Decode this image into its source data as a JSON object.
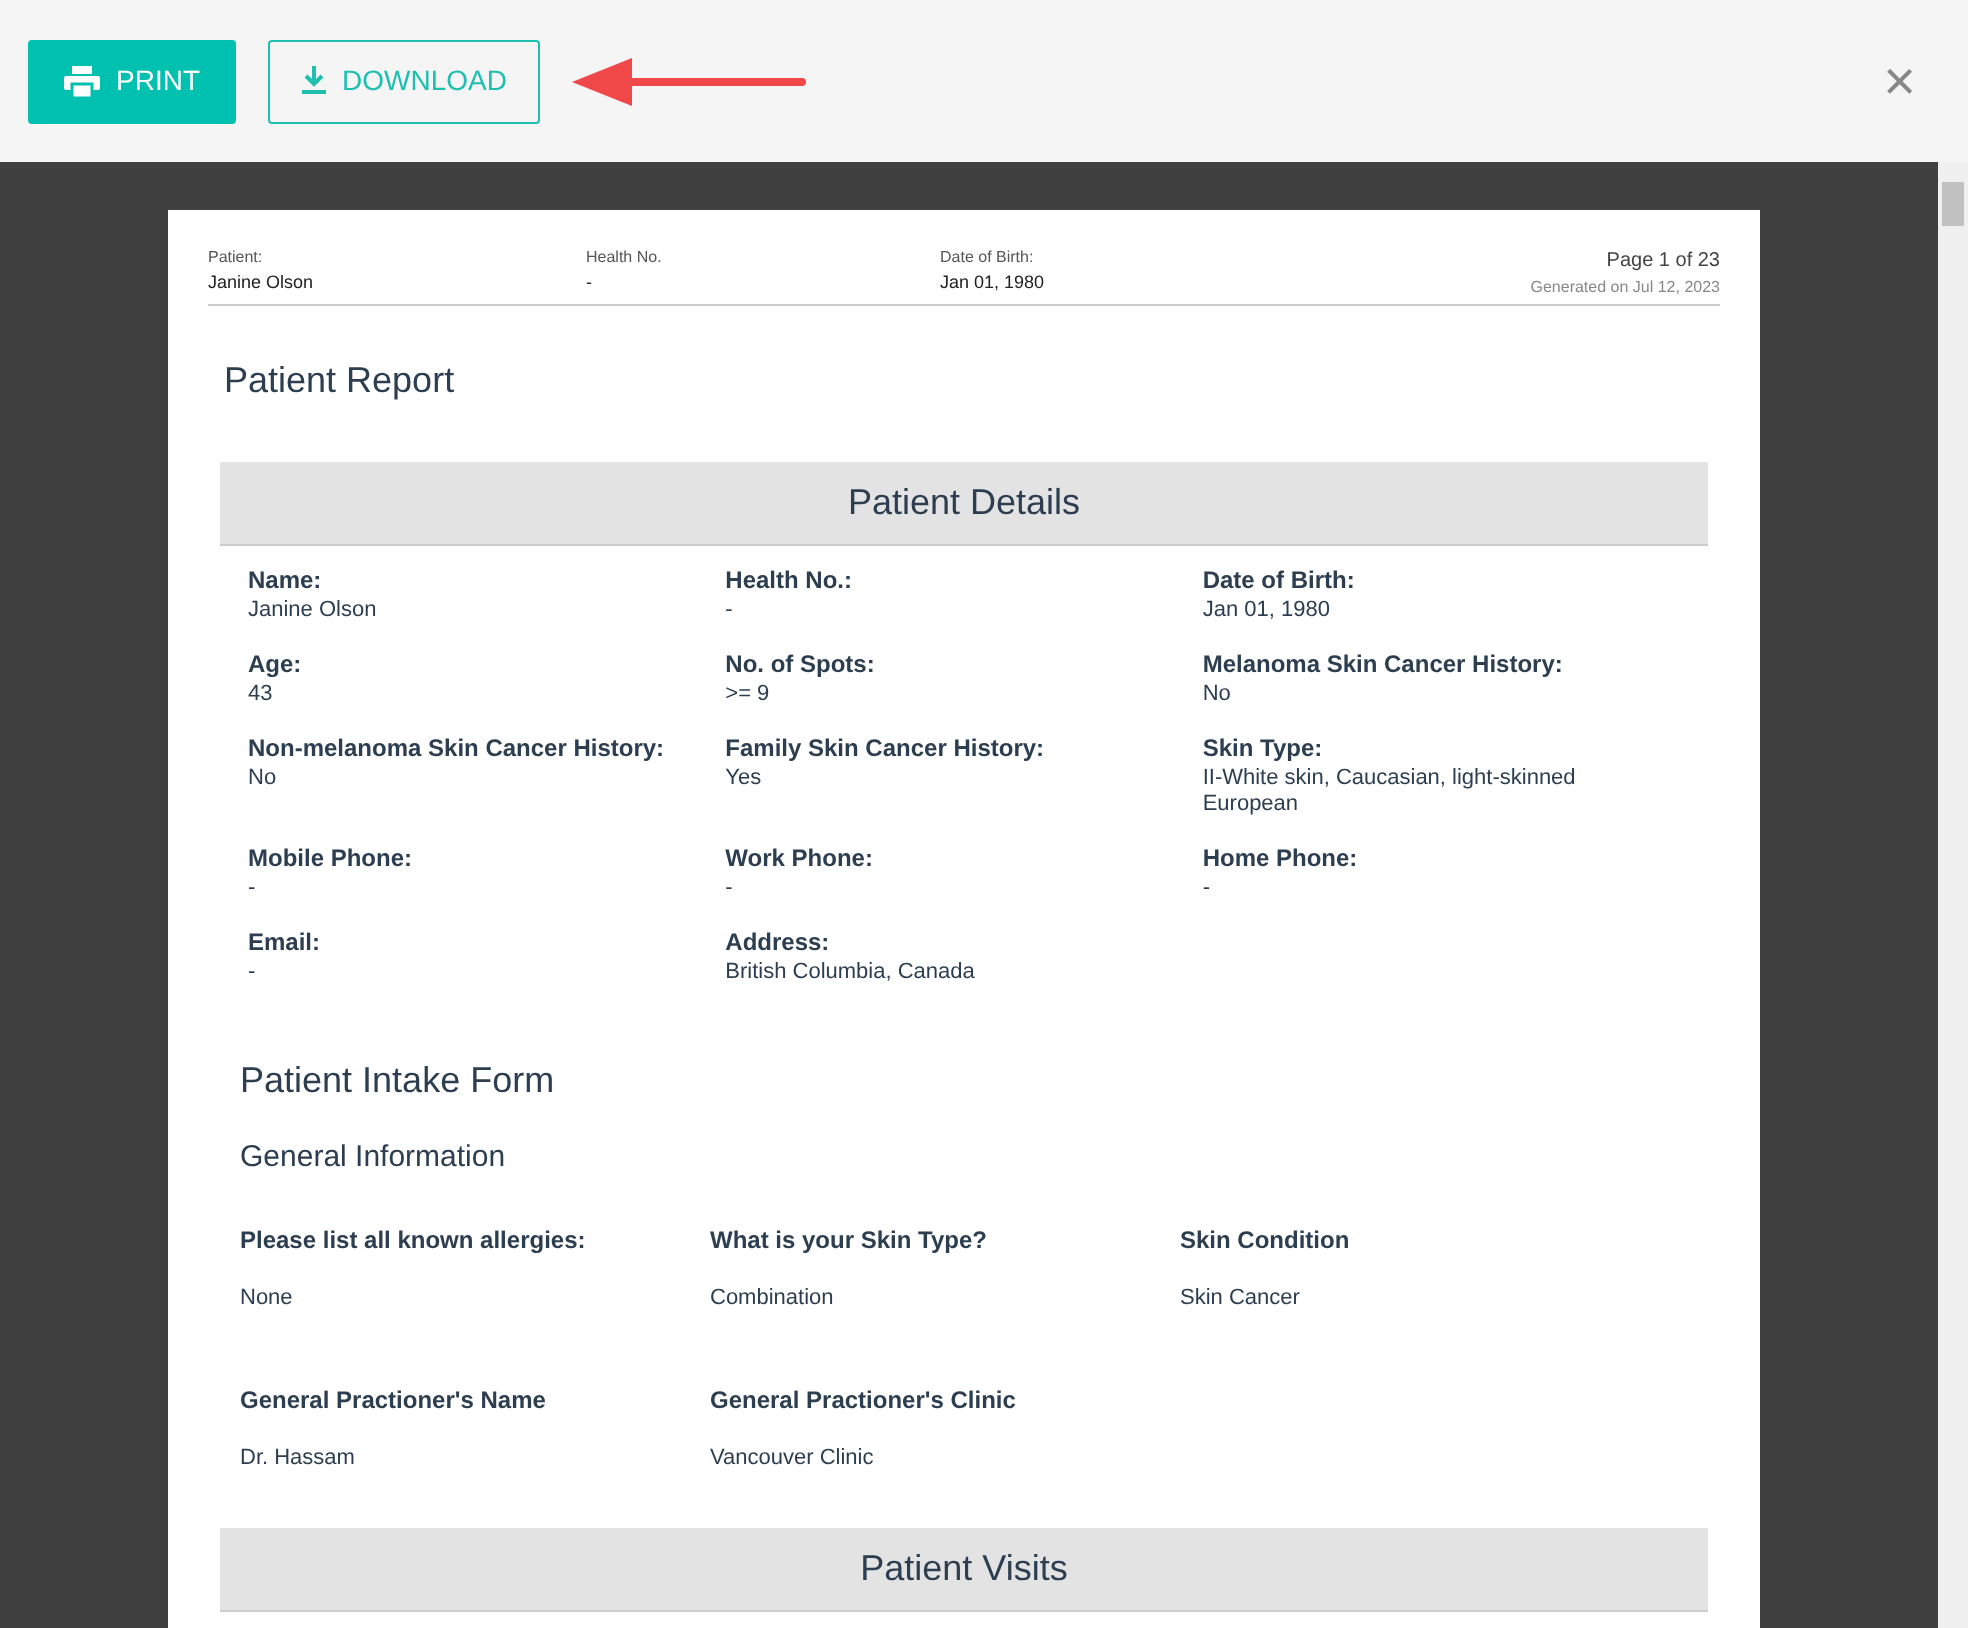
{
  "toolbar": {
    "print_button": "PRINT",
    "download_button": "DOWNLOAD",
    "close": "×"
  },
  "page_header": {
    "fields": [
      {
        "label": "Patient:",
        "value": "Janine Olson"
      },
      {
        "label": "Health No.",
        "value": "-"
      },
      {
        "label": "Date of Birth:",
        "value": "Jan 01, 1980"
      }
    ],
    "page": "Page 1 of 23",
    "generated": "Generated on Jul 12, 2023"
  },
  "report_title": "Patient Report",
  "patient_details": {
    "title": "Patient Details",
    "fields": [
      {
        "label": "Name:",
        "value": "Janine Olson"
      },
      {
        "label": "Health No.:",
        "value": "-"
      },
      {
        "label": "Date of Birth:",
        "value": "Jan 01, 1980"
      },
      {
        "label": "Age:",
        "value": "43"
      },
      {
        "label": "No. of Spots:",
        "value": ">= 9"
      },
      {
        "label": "Melanoma Skin Cancer History:",
        "value": "No"
      },
      {
        "label": "Non-melanoma Skin Cancer History:",
        "value": "No"
      },
      {
        "label": "Family Skin Cancer History:",
        "value": "Yes"
      },
      {
        "label": "Skin Type:",
        "value": "II-White skin, Caucasian, light-skinned European"
      },
      {
        "label": "Mobile Phone:",
        "value": "-"
      },
      {
        "label": "Work Phone:",
        "value": "-"
      },
      {
        "label": "Home Phone:",
        "value": "-"
      },
      {
        "label": "Email:",
        "value": "-"
      },
      {
        "label": "Address:",
        "value": "British Columbia, Canada"
      }
    ]
  },
  "intake_form": {
    "title": "Patient Intake Form",
    "subtitle": "General Information",
    "rows": [
      [
        {
          "question": "Please list all known allergies:",
          "answer": "None"
        },
        {
          "question": "What is your Skin Type?",
          "answer": "Combination"
        },
        {
          "question": "Skin Condition",
          "answer": "Skin Cancer"
        }
      ],
      [
        {
          "question": "General Practioner's Name",
          "answer": "Dr. Hassam"
        },
        {
          "question": "General Practioner's Clinic",
          "answer": "Vancouver Clinic"
        }
      ]
    ]
  },
  "visits": {
    "title": "Patient Visits"
  }
}
